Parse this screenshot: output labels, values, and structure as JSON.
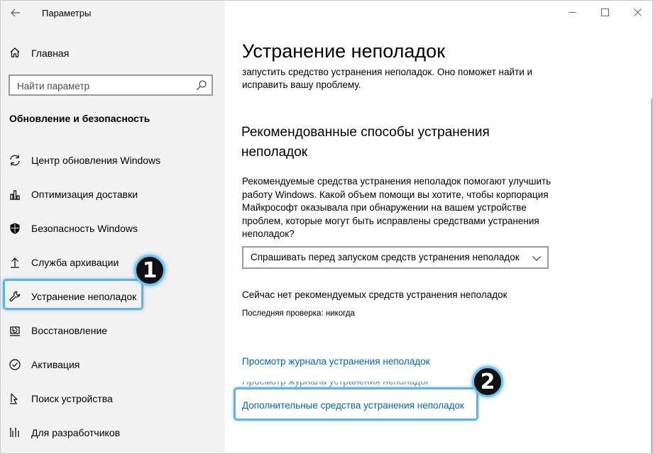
{
  "app": {
    "title": "Параметры"
  },
  "sidebar": {
    "home_label": "Главная",
    "search_placeholder": "Найти параметр",
    "section_title": "Обновление и безопасность",
    "items": [
      {
        "label": "Центр обновления Windows",
        "icon": "sync-icon"
      },
      {
        "label": "Оптимизация доставки",
        "icon": "delivery-optimization-icon"
      },
      {
        "label": "Безопасность Windows",
        "icon": "shield-icon"
      },
      {
        "label": "Служба архивации",
        "icon": "backup-icon"
      },
      {
        "label": "Устранение неполадок",
        "icon": "wrench-icon",
        "selected": true
      },
      {
        "label": "Восстановление",
        "icon": "recovery-icon"
      },
      {
        "label": "Активация",
        "icon": "check-circle-icon"
      },
      {
        "label": "Поиск устройства",
        "icon": "find-device-icon"
      },
      {
        "label": "Для разработчиков",
        "icon": "developer-icon"
      }
    ]
  },
  "main": {
    "title": "Устранение неполадок",
    "intro": "запустить средство устранения неполадок. Оно поможет найти и исправить вашу проблему.",
    "recommended_heading": "Рекомендованные способы устранения неполадок",
    "recommended_text": "Рекомендуемые средства устранения неполадок помогают улучшить работу Windows. Какой объем помощи вы хотите, чтобы корпорация Майкрософт оказывала при обнаружении на вашем устройстве проблем, которые могут быть исправлены средствами устранения неполадок?",
    "dropdown_value": "Спрашивать перед запуском средств устранения неполадок",
    "status": "Сейчас нет рекомендуемых средств устранения неполадок",
    "last_check": "Последняя проверка: никогда",
    "link_history": "Просмотр журнала устранения неполадок",
    "link_additional": "Дополнительные средства устранения неполадок"
  },
  "annotations": {
    "badge1": "1",
    "badge2": "2",
    "color": "#5bb4e5"
  },
  "colors": {
    "sidebar_bg": "#f2f2f2",
    "link": "#0067b8"
  }
}
